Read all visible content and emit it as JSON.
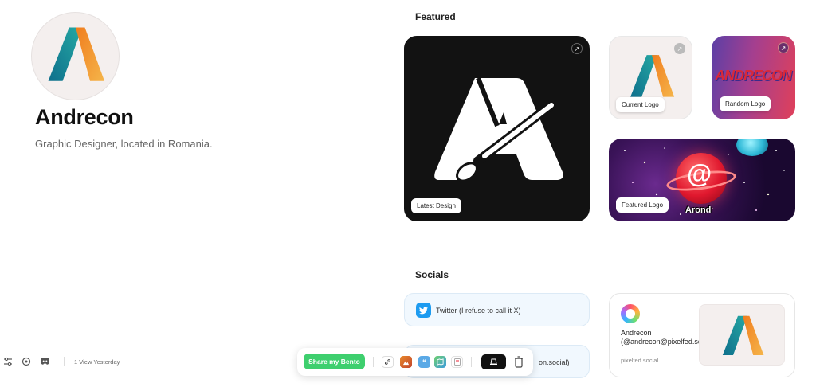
{
  "profile": {
    "name": "Andrecon",
    "bio": "Graphic Designer, located in Romania."
  },
  "featured": {
    "title": "Featured",
    "cards": {
      "latest_design": "Latest Design",
      "current_logo": "Current Logo",
      "random_logo": "Random Logo",
      "featured_logo": "Featured Logo"
    },
    "random_logo_text": "ANDRECON",
    "featured_logo_text": "Arond",
    "featured_logo_symbol": "@"
  },
  "socials": {
    "title": "Socials",
    "twitter_label": "Twitter (I refuse to call it X)",
    "mastodon_label_visible": "on.social)",
    "pixelfed_name": "Andrecon (@andrecon@pixelfed.social)",
    "pixelfed_domain": "pixelfed.social"
  },
  "footer": {
    "views": "1 View Yesterday"
  },
  "toolbar": {
    "share_label": "Share my Bento"
  },
  "colors": {
    "share_green": "#3ecf6e",
    "twitter_blue": "#1d9bf0",
    "logo_teal": "#1a8aa0",
    "logo_orange": "#f0a028"
  }
}
